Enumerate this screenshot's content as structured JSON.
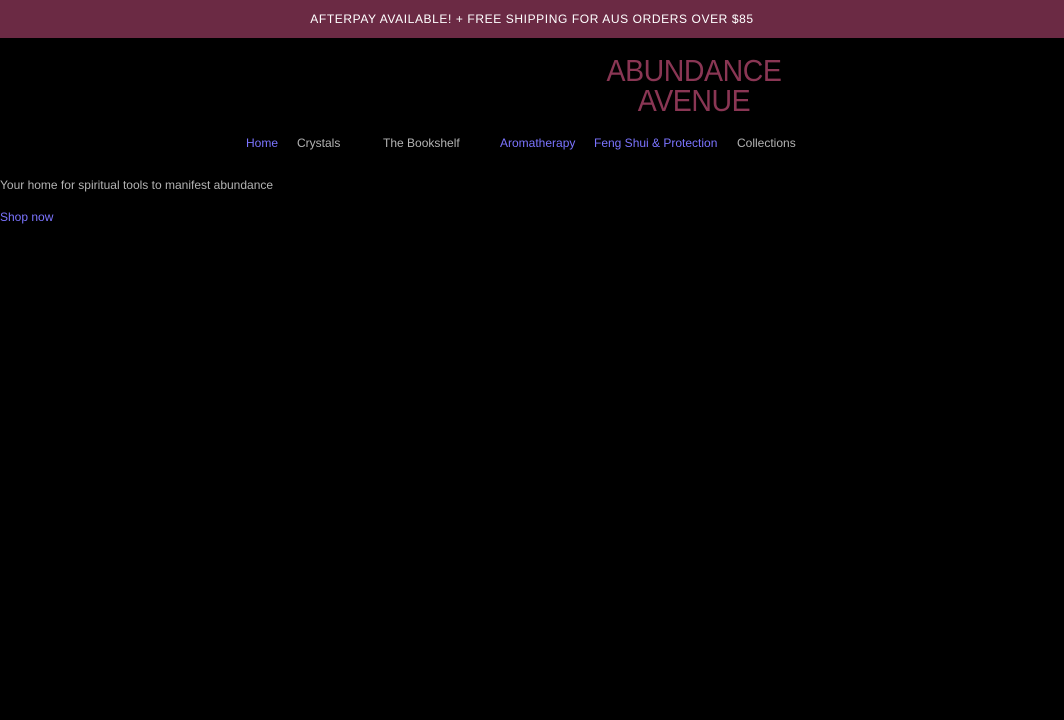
{
  "announcement": {
    "text": "AFTERPAY AVAILABLE! + FREE SHIPPING FOR AUS ORDERS OVER $85"
  },
  "logo": {
    "line1": "ABUNDANCE",
    "line2": "AVENUE"
  },
  "nav": {
    "items": [
      {
        "label": "Home"
      },
      {
        "label": "Crystals"
      },
      {
        "label": "The Bookshelf"
      },
      {
        "label": "Aromatherapy"
      },
      {
        "label": "Feng Shui & Protection"
      },
      {
        "label": "Collections"
      }
    ]
  },
  "hero": {
    "tagline": "Your home for spiritual tools to manifest abundance",
    "cta": "Shop now"
  },
  "colors": {
    "announcement_bg": "#6b2a44",
    "logo": "#8a3654",
    "link_blue": "#7b74ff",
    "link_gray": "#b3b3b3",
    "page_bg": "#000000"
  }
}
